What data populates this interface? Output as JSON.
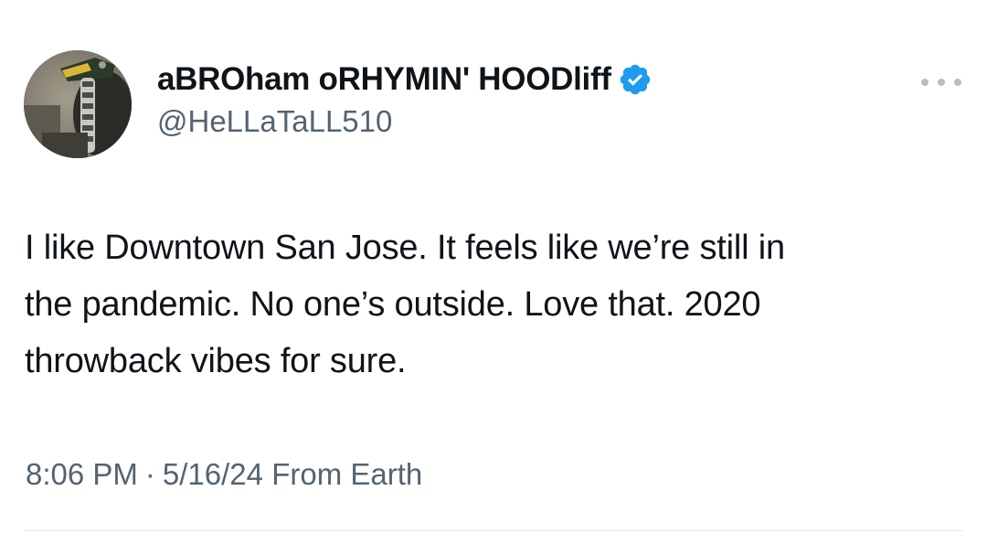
{
  "tweet": {
    "author": {
      "display_name": "aBROham oRHYMIN' HOODliff",
      "handle": "@HeLLaTaLL510",
      "verified": true,
      "verified_icon": "verified-badge-icon",
      "verified_color": "#1d9bf0"
    },
    "menu_icon": "more-horizontal-icon",
    "text_lines": [
      "I like Downtown San Jose. It feels like we’re still in",
      "the pandemic. No one’s outside.  Love that. 2020",
      "throwback vibes for sure."
    ],
    "time": "8:06 PM",
    "separator": "·",
    "date": "5/16/24",
    "location": "From Earth"
  }
}
